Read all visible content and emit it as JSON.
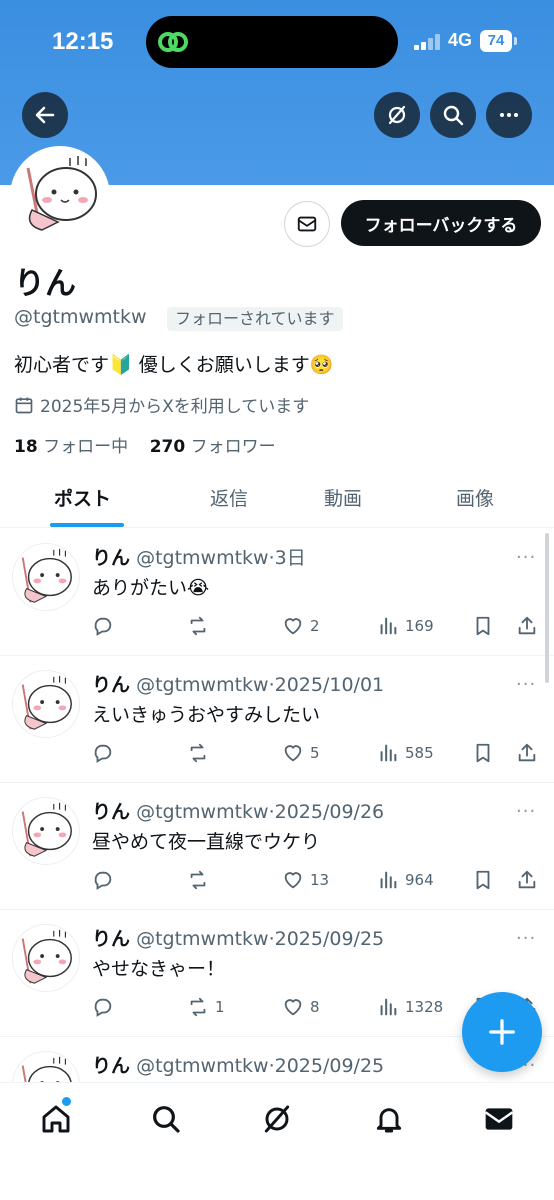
{
  "status_bar": {
    "time": "12:15",
    "network": "4G",
    "battery": "74"
  },
  "profile": {
    "name": "りん",
    "handle": "@tgtmwmtkw",
    "follows_you": "フォローされています",
    "follow_back_label": "フォローバックする",
    "bio": "初心者です🔰 優しくお願いします🥺",
    "joined": "2025年5月からXを利用しています",
    "following_count": "18",
    "following_label": "フォロー中",
    "followers_count": "270",
    "followers_label": "フォロワー"
  },
  "tabs": [
    {
      "label": "ポスト",
      "active": true
    },
    {
      "label": "返信",
      "active": false
    },
    {
      "label": "動画",
      "active": false
    },
    {
      "label": "画像",
      "active": false
    }
  ],
  "posts": [
    {
      "name": "りん",
      "handle": "@tgtmwmtkw",
      "time": "3日",
      "text": "ありがたい😭",
      "reposts": "",
      "likes": "2",
      "views": "169"
    },
    {
      "name": "りん",
      "handle": "@tgtmwmtkw",
      "time": "2025/10/01",
      "text": "えいきゅうおやすみしたい",
      "reposts": "",
      "likes": "5",
      "views": "585"
    },
    {
      "name": "りん",
      "handle": "@tgtmwmtkw",
      "time": "2025/09/26",
      "text": "昼やめて夜一直線でウケり",
      "reposts": "",
      "likes": "13",
      "views": "964"
    },
    {
      "name": "りん",
      "handle": "@tgtmwmtkw",
      "time": "2025/09/25",
      "text": "やせなきゃー！",
      "reposts": "1",
      "likes": "8",
      "views": "1328"
    },
    {
      "name": "りん",
      "handle": "@tgtmwmtkw",
      "time": "2025/09/25",
      "text": "",
      "reposts": "",
      "likes": "",
      "views": ""
    }
  ],
  "icons": {
    "back": "arrow-left-icon",
    "grok": "grok-icon",
    "search": "search-icon",
    "more": "more-icon",
    "message": "envelope-icon",
    "calendar": "calendar-icon",
    "reply": "reply-icon",
    "repost": "repost-icon",
    "like": "heart-icon",
    "views": "views-icon",
    "bookmark": "bookmark-icon",
    "share": "share-icon",
    "compose": "plus-icon",
    "home": "home-icon",
    "notifications": "bell-icon"
  },
  "colors": {
    "banner": "#3b8fe0",
    "accent": "#1d9bf0",
    "text": "#0f1419",
    "secondary": "#536471"
  }
}
